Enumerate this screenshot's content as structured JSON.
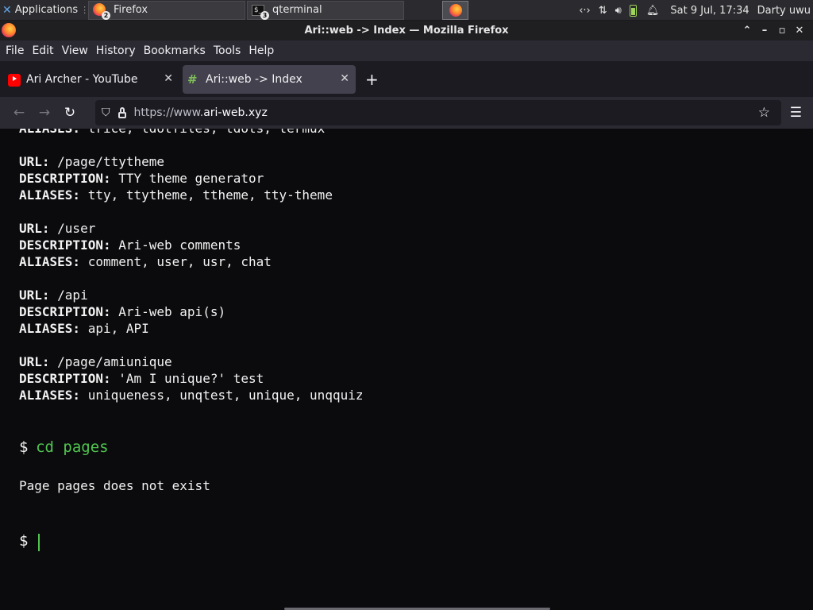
{
  "taskbar": {
    "apps_label": "Applications",
    "tasks": [
      {
        "label": "Firefox",
        "count": "2"
      },
      {
        "label": "qterminal",
        "count": "3"
      }
    ],
    "clock": "Sat  9 Jul, 17:34",
    "user": "Darty uwu"
  },
  "window": {
    "title": "Ari::web -> Index — Mozilla Firefox"
  },
  "menubar": {
    "items": [
      "File",
      "Edit",
      "View",
      "History",
      "Bookmarks",
      "Tools",
      "Help"
    ]
  },
  "tabs": [
    {
      "title": "Ari Archer - YouTube",
      "active": false
    },
    {
      "title": "Ari::web -> Index",
      "active": true
    }
  ],
  "navbar": {
    "url_prefix": "https://www.",
    "url_domain": "ari-web.xyz"
  },
  "terminal": {
    "partial_line": {
      "key": "ALIASES",
      "value": " trice, tdotfiles, tdots, termux"
    },
    "entries": [
      {
        "url": " /page/ttytheme",
        "description": " TTY theme generator",
        "aliases": " tty, ttytheme, ttheme, tty-theme"
      },
      {
        "url": " /user",
        "description": " Ari-web comments",
        "aliases": " comment, user, usr, chat"
      },
      {
        "url": " /api",
        "description": " Ari-web api(s)",
        "aliases": " api, API"
      },
      {
        "url": " /page/amiunique",
        "description": " 'Am I unique?' test",
        "aliases": " uniqueness, unqtest, unique, unqquiz"
      }
    ],
    "labels": {
      "url": "URL:",
      "description": "DESCRIPTION:",
      "aliases": "ALIASES:"
    },
    "prompt": "$",
    "command": "cd pages",
    "output": "Page pages does not exist"
  },
  "colors": {
    "accent_green": "#4fc54f",
    "background": "#0b0b0d"
  }
}
